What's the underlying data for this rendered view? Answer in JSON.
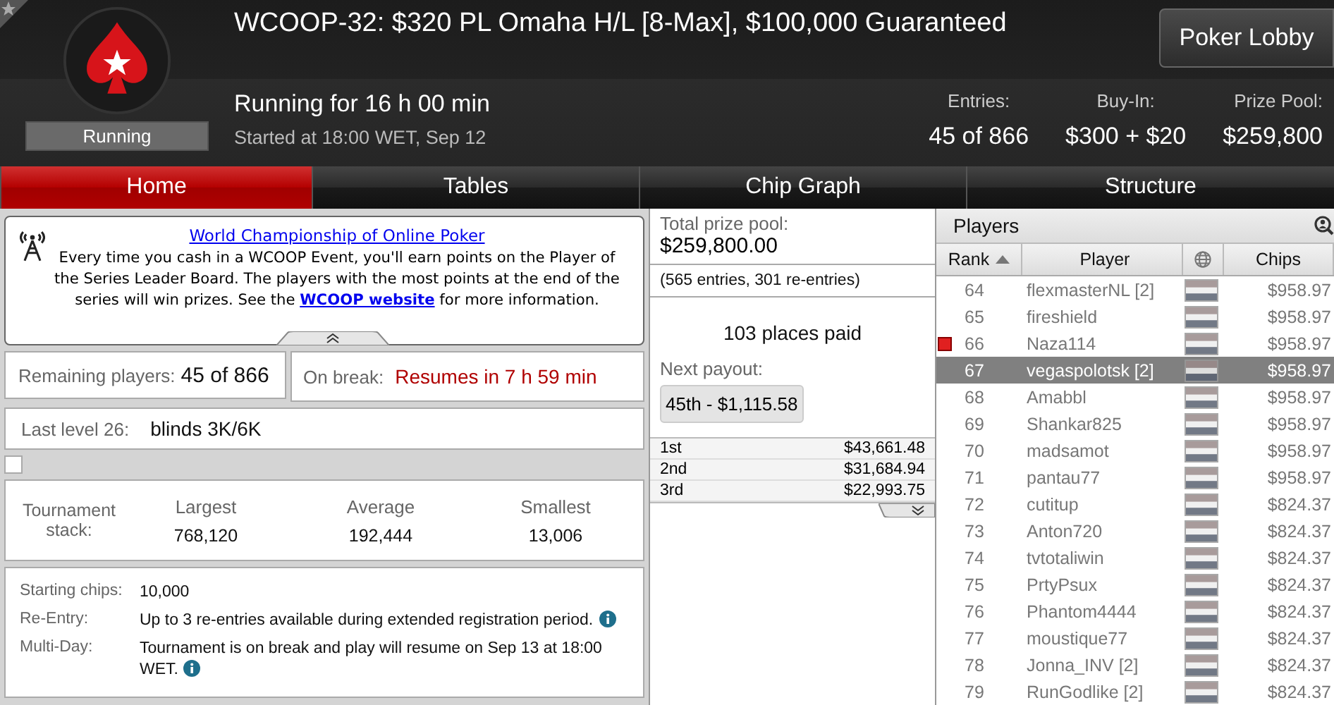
{
  "header": {
    "title": "WCOOP-32: $320 PL Omaha H/L [8-Max], $100,000 Guaranteed",
    "status_badge": "Running",
    "running_for": "Running for 16 h 00 min",
    "started": "Started at 18:00 WET, Sep 12",
    "lobby_button": "Poker Lobby",
    "stats": [
      {
        "label": "Entries:",
        "value": "45 of 866"
      },
      {
        "label": "Buy-In:",
        "value": "$300 + $20"
      },
      {
        "label": "Prize Pool:",
        "value": "$259,800"
      }
    ]
  },
  "tabs": [
    {
      "label": "Home",
      "selected": true
    },
    {
      "label": "Tables",
      "selected": false
    },
    {
      "label": "Chip Graph",
      "selected": false
    },
    {
      "label": "Structure",
      "selected": false
    }
  ],
  "news": {
    "title": "World Championship of Online Poker",
    "text": "Every time you cash in a WCOOP Event, you'll earn points on the Player of the Series Leader Board. The players with the most points at the end of the series will win prizes. See the",
    "link": "WCOOP website",
    "text_end": "for more information."
  },
  "remaining": {
    "label": "Remaining players:",
    "value": "45 of 866"
  },
  "break": {
    "label": "On break:",
    "value": "Resumes in 7 h 59 min"
  },
  "last_level": {
    "label": "Last level 26:",
    "value": "blinds 3K/6K"
  },
  "checkbox": {
    "checked": false
  },
  "stack": {
    "label": "Tournament stack:",
    "columns": [
      {
        "label": "Largest",
        "value": "768,120"
      },
      {
        "label": "Average",
        "value": "192,444"
      },
      {
        "label": "Smallest",
        "value": "13,006"
      }
    ]
  },
  "details": [
    {
      "label": "Starting chips:",
      "value": "10,000",
      "info": false
    },
    {
      "label": "Re-Entry:",
      "value": "Up to 3 re-entries available during extended registration period.",
      "info": true
    },
    {
      "label": "Multi-Day:",
      "value": "Tournament is on break and play will resume on Sep 13 at 18:00 WET.",
      "info": true
    }
  ],
  "prizes": {
    "total_label": "Total prize pool:",
    "total": "$259,800.00",
    "entries": "(565 entries, 301 re-entries)",
    "places": "103 places paid",
    "next_label": "Next payout:",
    "next": "45th - $1,115.58",
    "payouts": [
      {
        "place": "1st",
        "amount": "$43,661.48"
      },
      {
        "place": "2nd",
        "amount": "$31,684.94"
      },
      {
        "place": "3rd",
        "amount": "$22,993.75"
      }
    ]
  },
  "players": {
    "title": "Players",
    "columns": [
      "Rank",
      "Player",
      "Chips"
    ],
    "rows": [
      {
        "rank": "64",
        "name": "flexmasterNL [2]",
        "chips": "$958.97",
        "selected": false,
        "marked": false
      },
      {
        "rank": "65",
        "name": "fireshield",
        "chips": "$958.97",
        "selected": false,
        "marked": false
      },
      {
        "rank": "66",
        "name": "Naza114",
        "chips": "$958.97",
        "selected": false,
        "marked": true
      },
      {
        "rank": "67",
        "name": "vegaspolotsk [2]",
        "chips": "$958.97",
        "selected": true,
        "marked": false
      },
      {
        "rank": "68",
        "name": "Amabbl",
        "chips": "$958.97",
        "selected": false,
        "marked": false
      },
      {
        "rank": "69",
        "name": "Shankar825",
        "chips": "$958.97",
        "selected": false,
        "marked": false
      },
      {
        "rank": "70",
        "name": "madsamot",
        "chips": "$958.97",
        "selected": false,
        "marked": false
      },
      {
        "rank": "71",
        "name": "pantau77",
        "chips": "$958.97",
        "selected": false,
        "marked": false
      },
      {
        "rank": "72",
        "name": "cutitup",
        "chips": "$824.37",
        "selected": false,
        "marked": false
      },
      {
        "rank": "73",
        "name": "Anton720",
        "chips": "$824.37",
        "selected": false,
        "marked": false
      },
      {
        "rank": "74",
        "name": "tvtotaliwin",
        "chips": "$824.37",
        "selected": false,
        "marked": false
      },
      {
        "rank": "75",
        "name": "PrtyPsux",
        "chips": "$824.37",
        "selected": false,
        "marked": false
      },
      {
        "rank": "76",
        "name": "Phantom4444",
        "chips": "$824.37",
        "selected": false,
        "marked": false
      },
      {
        "rank": "77",
        "name": "moustique77",
        "chips": "$824.37",
        "selected": false,
        "marked": false
      },
      {
        "rank": "78",
        "name": "Jonna_INV [2]",
        "chips": "$824.37",
        "selected": false,
        "marked": false
      },
      {
        "rank": "79",
        "name": "RunGodlike [2]",
        "chips": "$824.37",
        "selected": false,
        "marked": false
      }
    ]
  }
}
